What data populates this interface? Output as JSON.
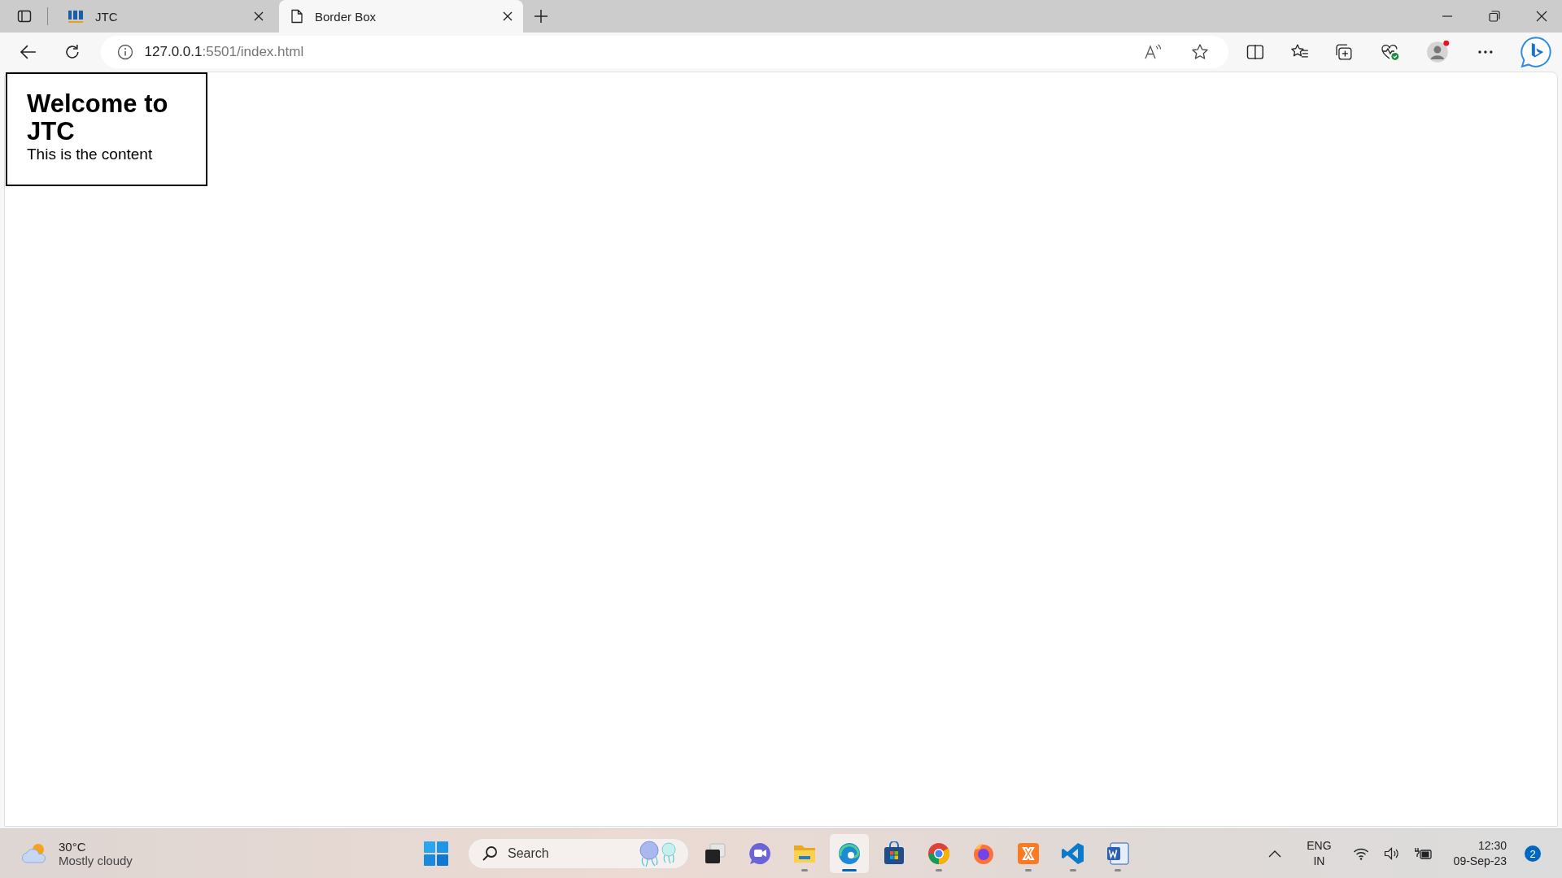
{
  "browser": {
    "tabs": [
      {
        "title": "JTC",
        "selected": false,
        "kind": "logo"
      },
      {
        "title": "Border Box",
        "selected": true,
        "kind": "page"
      }
    ],
    "address": {
      "host": "127.0.0.1",
      "rest": ":5501/index.html"
    }
  },
  "page": {
    "heading": "Welcome to JTC",
    "content": "This is the content"
  },
  "taskbar": {
    "weather": {
      "temp": "30°C",
      "condition": "Mostly cloudy"
    },
    "search": {
      "placeholder": "Search"
    },
    "apps": [
      {
        "kind": "taskview",
        "active": false,
        "running": false
      },
      {
        "kind": "chat",
        "active": false,
        "running": false
      },
      {
        "kind": "explorer",
        "active": false,
        "running": true
      },
      {
        "kind": "edge",
        "active": true,
        "running": true
      },
      {
        "kind": "store",
        "active": false,
        "running": false
      },
      {
        "kind": "chrome",
        "active": false,
        "running": true
      },
      {
        "kind": "firefox",
        "active": false,
        "running": false
      },
      {
        "kind": "xampp",
        "active": false,
        "running": true
      },
      {
        "kind": "vscode",
        "active": false,
        "running": true
      },
      {
        "kind": "word",
        "active": false,
        "running": true
      }
    ],
    "tray": {
      "language": "ENG",
      "region": "IN",
      "time": "12:30",
      "date": "09-Sep-23",
      "notifications": "2"
    }
  }
}
